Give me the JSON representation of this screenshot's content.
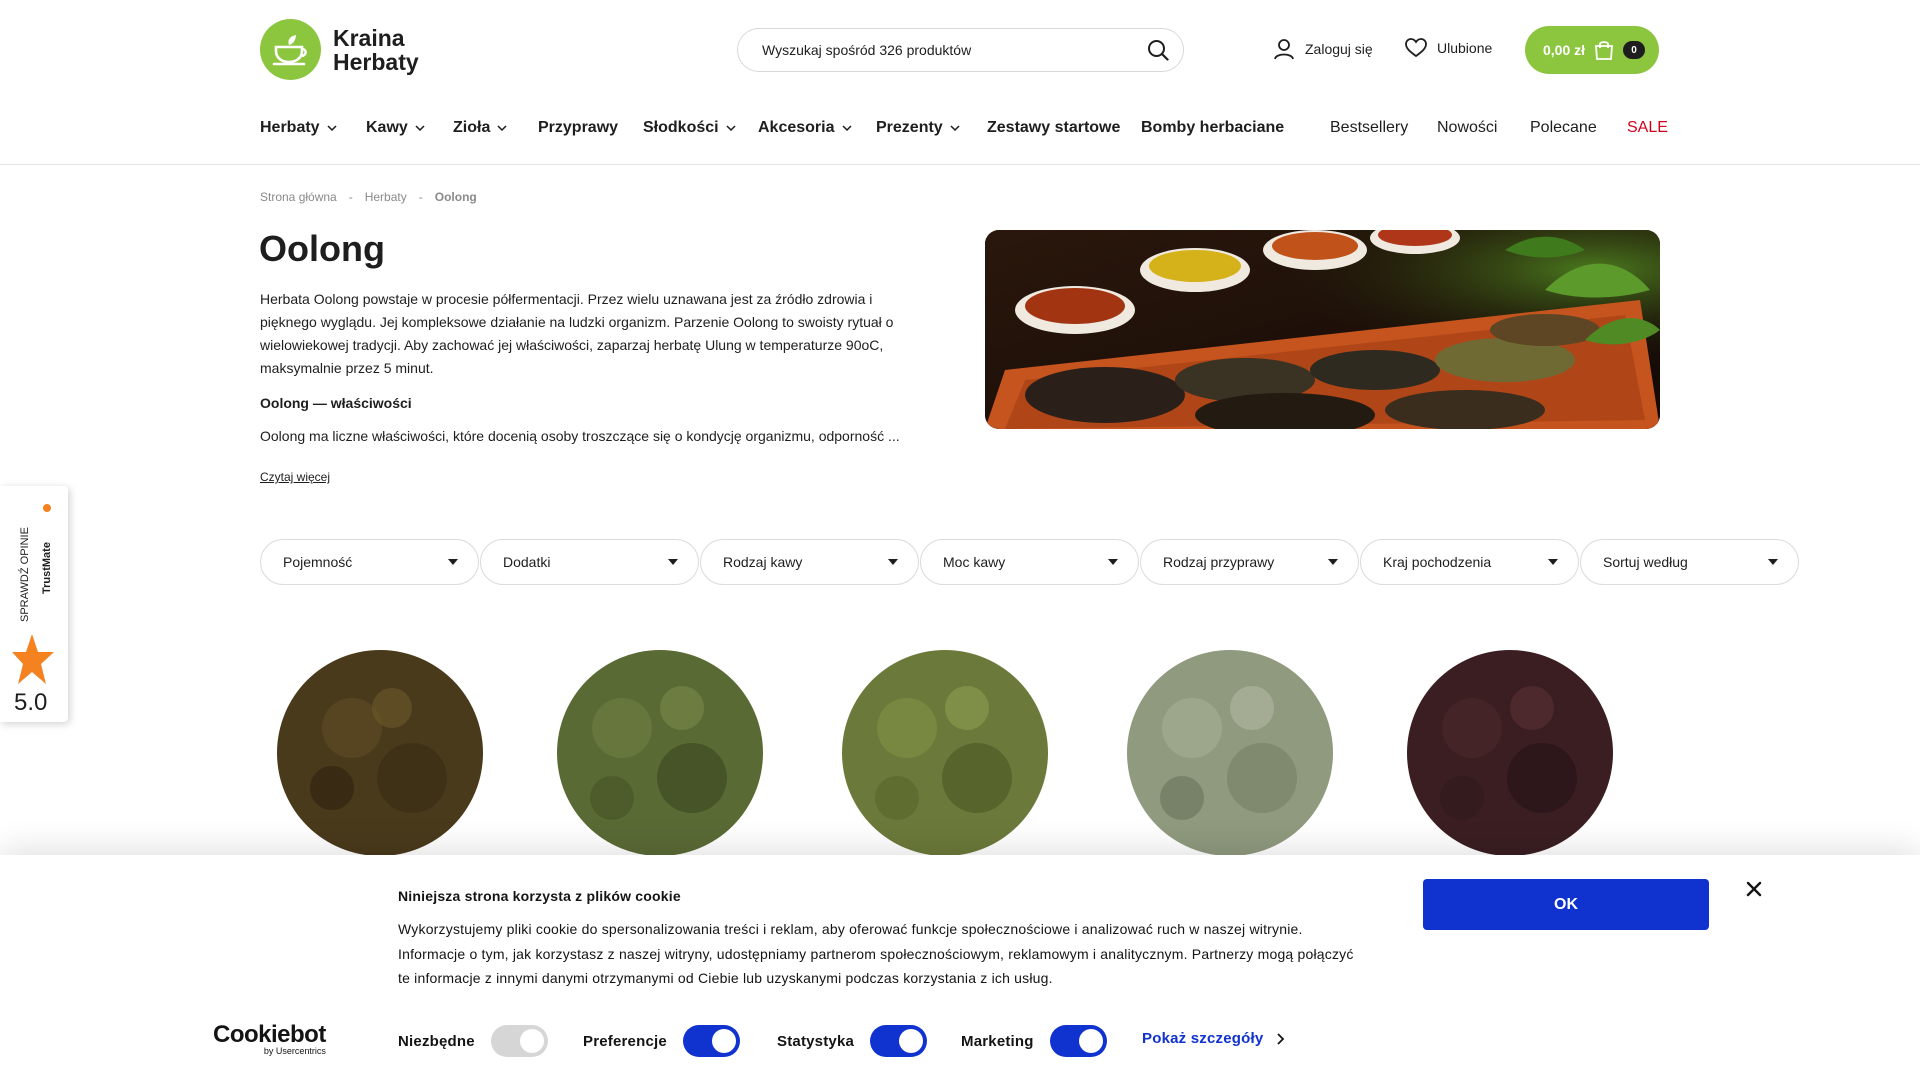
{
  "header": {
    "logo_line1": "Kraina",
    "logo_line2": "Herbaty",
    "search_placeholder": "Wyszukaj spośród 326 produktów",
    "login": "Zaloguj się",
    "favorites": "Ulubione",
    "cart_total": "0,00 zł",
    "cart_count": "0",
    "brand_color": "#8cc63f"
  },
  "nav": {
    "items": [
      {
        "label": "Herbaty",
        "dropdown": true
      },
      {
        "label": "Kawy",
        "dropdown": true
      },
      {
        "label": "Zioła",
        "dropdown": true
      },
      {
        "label": "Przyprawy",
        "dropdown": false
      },
      {
        "label": "Słodkości",
        "dropdown": true
      },
      {
        "label": "Akcesoria",
        "dropdown": true
      },
      {
        "label": "Prezenty",
        "dropdown": true
      },
      {
        "label": "Zestawy startowe",
        "dropdown": false
      },
      {
        "label": "Bomby herbaciane",
        "dropdown": false
      }
    ],
    "right": [
      "Bestsellery",
      "Nowości",
      "Polecane",
      "SALE"
    ],
    "sale_color": "#d0021b"
  },
  "breadcrumb": [
    "Strona główna",
    "-",
    "Herbaty",
    "-",
    "Oolong"
  ],
  "category": {
    "title": "Oolong",
    "description": "Herbata Oolong powstaje w procesie półfermentacji. Przez wielu uznawana jest za źródło zdrowia i pięknego wyglądu. Jej kompleksowe działanie na ludzki organizm. Parzenie Oolong to swoisty rytuał o wielowiekowej tradycji. Aby zachować jej właściwości, zaparzaj herbatę Ulung w temperaturze 90oC, maksymalnie przez 5 minut.",
    "subheading": "Oolong — właściwości",
    "description2": "Oolong ma liczne właściwości, które docenią osoby troszczące się o kondycję organizmu, odporność ...",
    "read_more": "Czytaj więcej"
  },
  "filters": [
    "Pojemność",
    "Dodatki",
    "Rodzaj kawy",
    "Moc kawy",
    "Rodzaj przyprawy",
    "Kraj pochodzenia",
    "Sortuj według"
  ],
  "products": [
    {
      "icon": "dark-oolong-leaves-image",
      "color": "#4a3a1c"
    },
    {
      "icon": "green-oolong-leaves-image",
      "color": "#5a6a35"
    },
    {
      "icon": "tieguanyin-leaves-image",
      "color": "#6b7a3a"
    },
    {
      "icon": "ginseng-oolong-image",
      "color": "#8f9a7e"
    },
    {
      "icon": "dark-red-oolong-image",
      "color": "#3a1e22"
    }
  ],
  "trustmate": {
    "label": "SPRAWDŹ OPINIE",
    "brand": "TrustMate",
    "score": "5.0"
  },
  "cookie": {
    "title": "Niniejsza strona korzysta z plików cookie",
    "body": "Wykorzystujemy pliki cookie do spersonalizowania treści i reklam, aby oferować funkcje społecznościowe i analizować ruch w naszej witrynie. Informacje o tym, jak korzystasz z naszej witryny, udostępniamy partnerom społecznościowym, reklamowym i analitycznym. Partnerzy mogą połączyć te informacje z innymi danymi otrzymanymi od Ciebie lub uzyskanymi podczas korzystania z ich usług.",
    "ok": "OK",
    "brand": "Cookiebot",
    "brand_sub": "by Usercentrics",
    "toggles": [
      {
        "label": "Niezbędne",
        "on": true,
        "disabled": true
      },
      {
        "label": "Preferencje",
        "on": true
      },
      {
        "label": "Statystyka",
        "on": true
      },
      {
        "label": "Marketing",
        "on": true
      }
    ],
    "details": "Pokaż szczegóły",
    "accent": "#1032cf"
  }
}
